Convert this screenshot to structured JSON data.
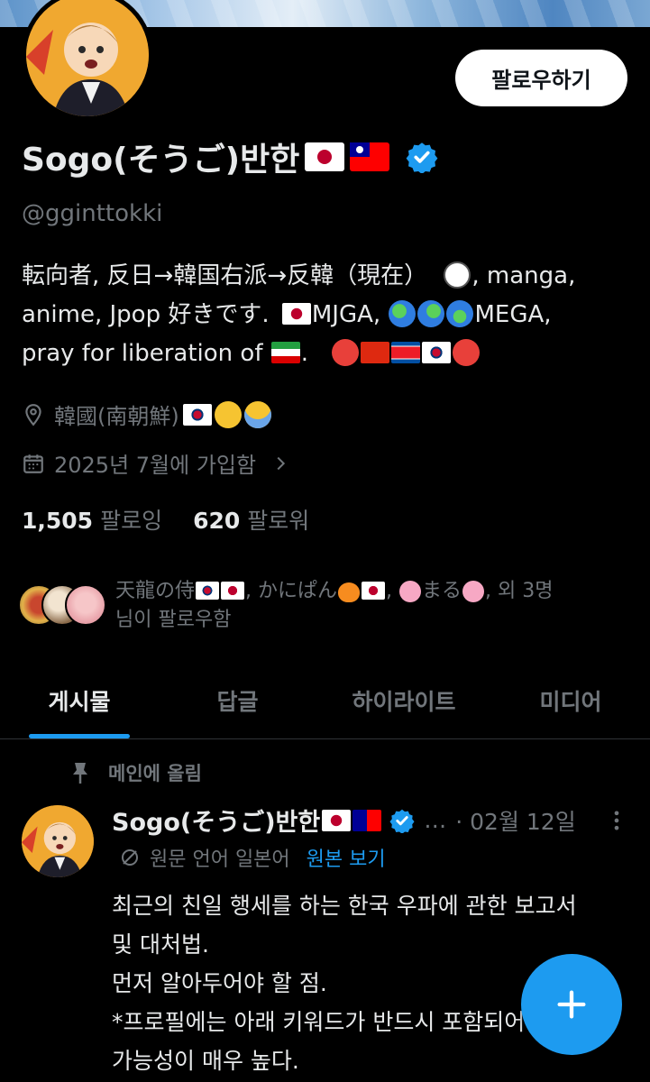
{
  "profile": {
    "display_name": "Sogo(そうご)반한",
    "handle": "@gginttokki",
    "follow_button": "팔로우하기",
    "bio_lines": [
      "転向者, 反日→韓国右派→反韓（現在）",
      ", manga,",
      "anime, Jpop 好きです.",
      "MJGA,",
      "MEGA,",
      "pray for liberation of",
      "."
    ],
    "location": "韓國(南朝鮮)",
    "joined": "2025년 7월에 가입함",
    "following_count": "1,505",
    "following_label": "팔로잉",
    "followers_count": "620",
    "followers_label": "팔로워",
    "followed_by": {
      "name1": "天龍の侍",
      "name2": "かにぱん",
      "name3": "まる",
      "tail": "외 3명",
      "line2": "님이 팔로우함"
    }
  },
  "tabs": [
    "게시물",
    "답글",
    "하이라이트",
    "미디어"
  ],
  "pinned_post": {
    "pinned_label": "메인에 올림",
    "author_name": "Sogo(そうご)반한",
    "ellipsis": "…",
    "date": "· 02월 12일",
    "translate_label": "원문 언어 일본어",
    "translate_link": "원본 보기",
    "body_lines": [
      "최근의 친일 행세를 하는 한국 우파에 관한 보고서",
      "및 대처법.",
      "먼저 알아두어야 할 점.",
      "*프로필에는 아래 키워드가 반드시 포함되어 있을",
      "가능성이 매우 높다."
    ]
  },
  "icons": {
    "verified": "verified-badge-icon",
    "location": "location-pin-icon",
    "calendar": "calendar-icon",
    "chevron": "chevron-right-icon",
    "pin": "pin-icon",
    "translate": "translate-icon",
    "more": "more-vertical-icon",
    "compose": "plus-icon"
  },
  "colors": {
    "accent": "#1d9bf0",
    "background": "#000000",
    "text": "#e7e9ea",
    "muted": "#71767b"
  }
}
